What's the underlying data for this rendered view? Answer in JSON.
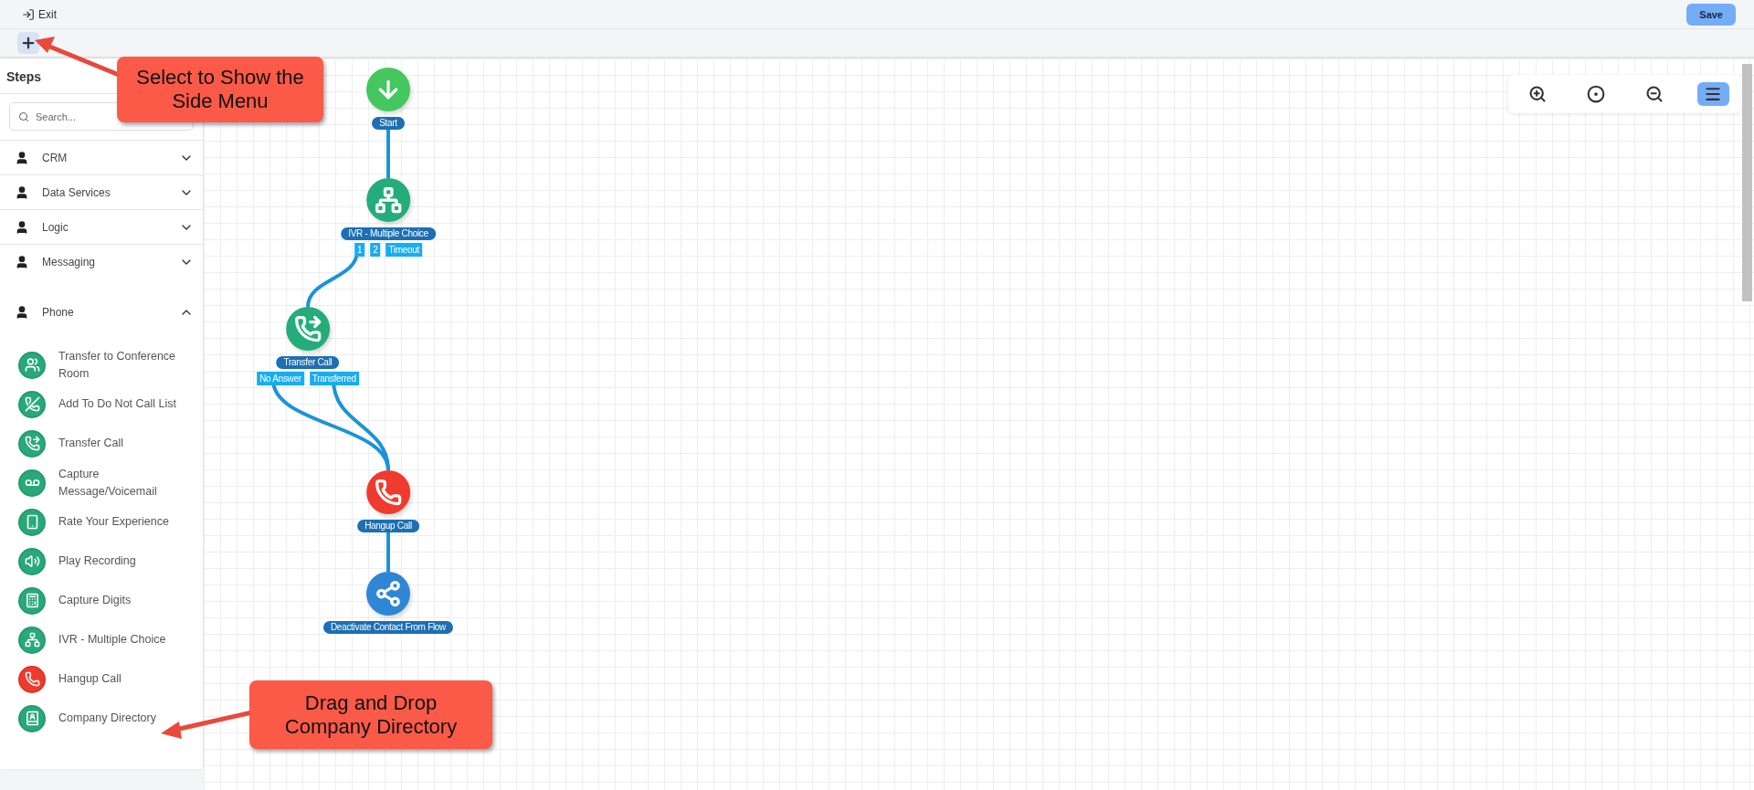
{
  "toolbar": {
    "exit_label": "Exit",
    "save_label": "Save"
  },
  "sidebar": {
    "title": "Steps",
    "search": {
      "placeholder": "Search..."
    },
    "categories": [
      {
        "label": "CRM",
        "expanded": false
      },
      {
        "label": "Data Services",
        "expanded": false
      },
      {
        "label": "Logic",
        "expanded": false
      },
      {
        "label": "Messaging",
        "expanded": false
      },
      {
        "label": "Phone",
        "expanded": true,
        "children": [
          {
            "label": "Transfer to Conference Room",
            "kind": "conference"
          },
          {
            "label": "Add To Do Not Call List",
            "kind": "do-not-call"
          },
          {
            "label": "Transfer Call",
            "kind": "transfer"
          },
          {
            "label": "Capture Message/Voicemail",
            "kind": "voicemail"
          },
          {
            "label": "Rate Your Experience",
            "kind": "rate"
          },
          {
            "label": "Play Recording",
            "kind": "recording"
          },
          {
            "label": "Capture Digits",
            "kind": "digits"
          },
          {
            "label": "IVR - Multiple Choice",
            "kind": "ivr"
          },
          {
            "label": "Hangup Call",
            "kind": "hangup"
          },
          {
            "label": "Company Directory",
            "kind": "directory"
          }
        ]
      }
    ]
  },
  "view_controls": [
    {
      "kind": "zoom-in",
      "selected": false
    },
    {
      "kind": "center",
      "selected": false
    },
    {
      "kind": "zoom-out",
      "selected": false
    },
    {
      "kind": "menu",
      "selected": true
    }
  ],
  "flow": {
    "nodes": [
      {
        "kind": "start",
        "label": "Start"
      },
      {
        "kind": "ivr",
        "label": "IVR - Multiple Choice",
        "ports": [
          "1",
          "2",
          "Timeout"
        ]
      },
      {
        "kind": "transfer",
        "label": "Transfer Call",
        "ports": [
          "No Answer",
          "Transferred"
        ]
      },
      {
        "kind": "hangup",
        "label": "Hangup Call"
      },
      {
        "kind": "deactivate",
        "label": "Deactivate Contact From Flow"
      }
    ]
  },
  "callouts": [
    {
      "text": "Select to Show the Side Menu"
    },
    {
      "text": "Drag and Drop Company Directory"
    }
  ]
}
